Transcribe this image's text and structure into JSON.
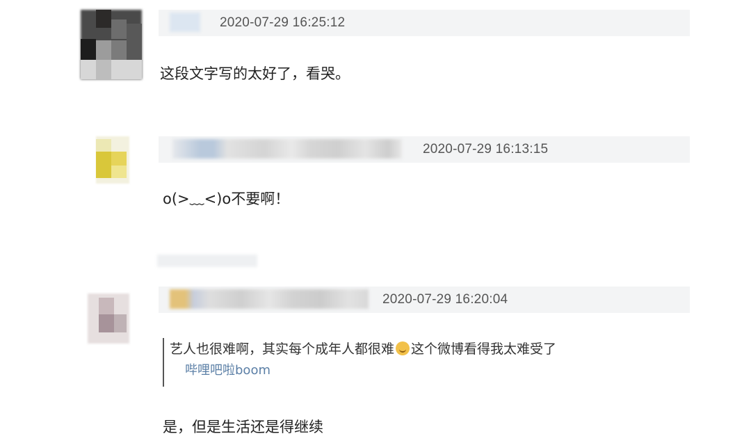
{
  "comments": [
    {
      "timestamp": "2020-07-29 16:25:12",
      "text": "这段文字写的太好了，看哭。"
    },
    {
      "timestamp": "2020-07-29 16:13:15",
      "text": "o(>﹏<)o不要啊！"
    },
    {
      "timestamp": "2020-07-29 16:20:04",
      "quote": {
        "text_before": "艺人也很难啊，其实每个成年人都很难",
        "emoji_icon": "sad-face-icon",
        "text_after": "这个微博看得我太难受了",
        "source": "哔哩吧啦boom"
      },
      "text": "是，但是生活还是得继续"
    }
  ]
}
